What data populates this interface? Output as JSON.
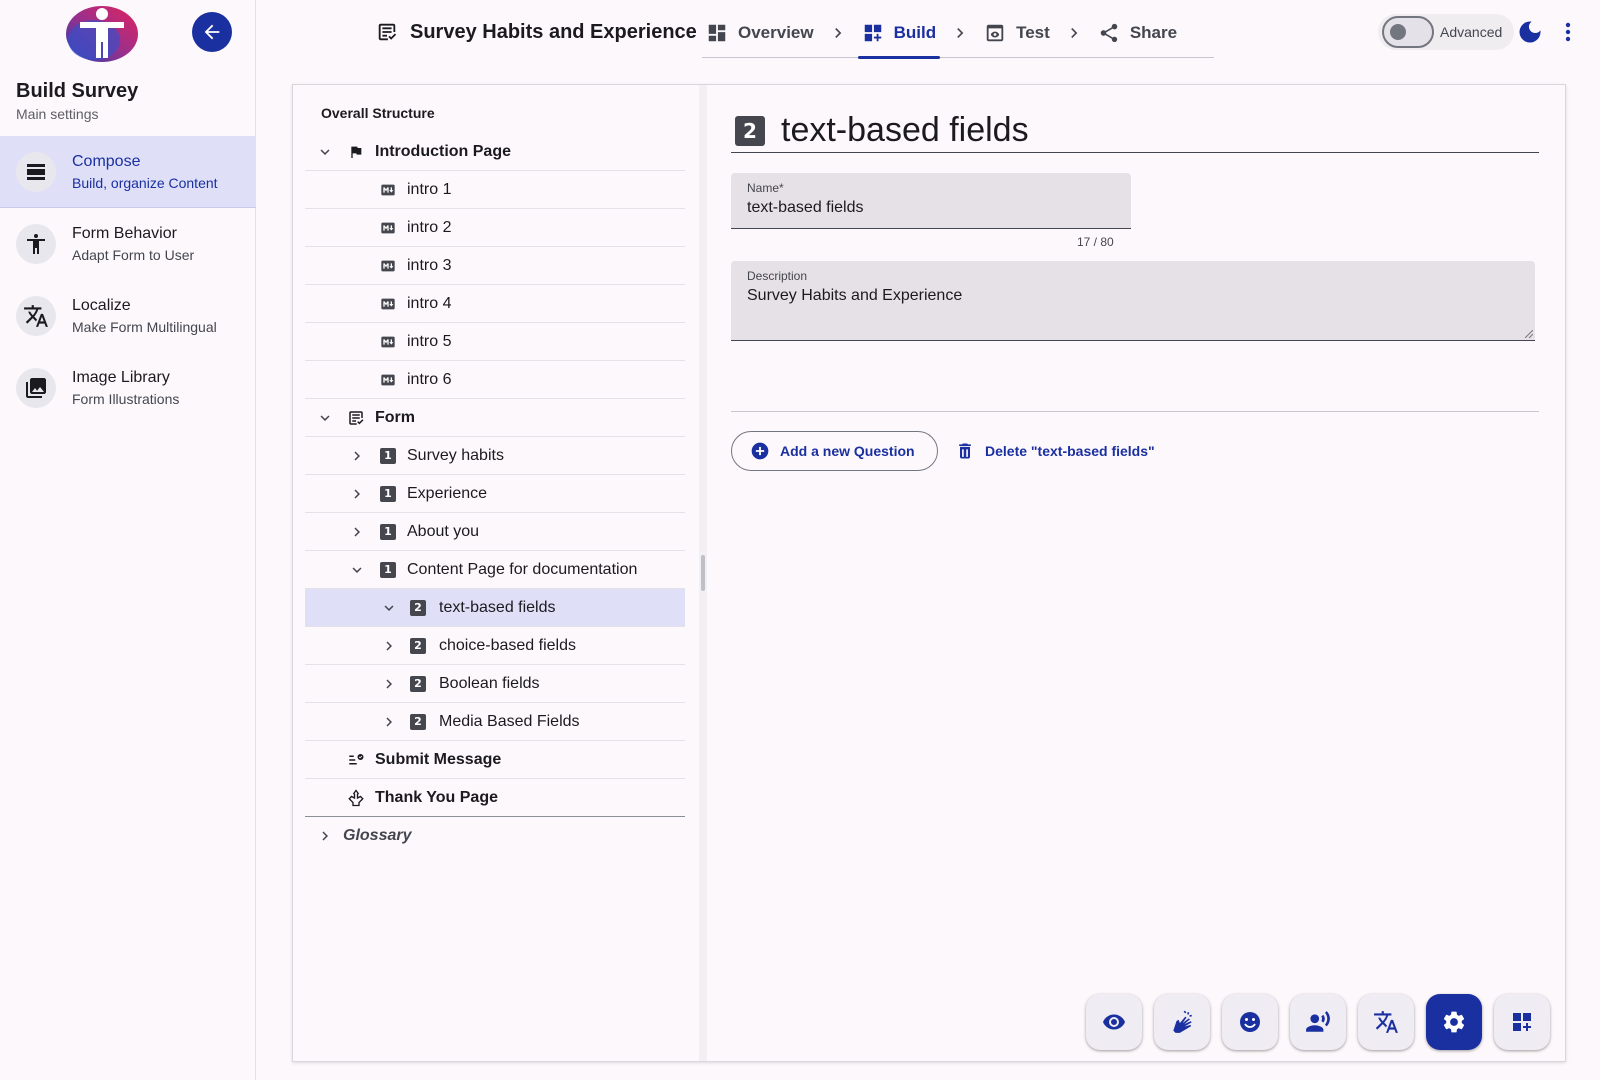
{
  "app": {
    "survey_title": "Survey Habits and Experience",
    "accent_color": "#1a2fa0"
  },
  "sidebar": {
    "title": "Build Survey",
    "subtitle": "Main settings",
    "items": [
      {
        "label": "Compose",
        "sub": "Build, organize Content",
        "icon": "compose-icon",
        "active": true
      },
      {
        "label": "Form Behavior",
        "sub": "Adapt Form to User",
        "icon": "accessibility-icon",
        "active": false
      },
      {
        "label": "Localize",
        "sub": "Make Form Multilingual",
        "icon": "translate-icon",
        "active": false
      },
      {
        "label": "Image Library",
        "sub": "Form Illustrations",
        "icon": "image-library-icon",
        "active": false
      }
    ]
  },
  "steps": [
    {
      "label": "Overview",
      "icon": "dashboard-icon",
      "active": false
    },
    {
      "label": "Build",
      "icon": "build-grid-icon",
      "active": true
    },
    {
      "label": "Test",
      "icon": "preview-icon",
      "active": false
    },
    {
      "label": "Share",
      "icon": "share-icon",
      "active": false
    }
  ],
  "advanced": {
    "label": "Advanced",
    "enabled": false
  },
  "tree": {
    "heading": "Overall Structure",
    "items": [
      {
        "label": "Introduction Page",
        "level": 0,
        "type": "section",
        "icon": "flag-icon",
        "expanded": true
      },
      {
        "label": "intro 1",
        "level": 1,
        "type": "markdown",
        "icon": "markdown-icon"
      },
      {
        "label": "intro 2",
        "level": 1,
        "type": "markdown",
        "icon": "markdown-icon"
      },
      {
        "label": "intro 3",
        "level": 1,
        "type": "markdown",
        "icon": "markdown-icon"
      },
      {
        "label": "intro 4",
        "level": 1,
        "type": "markdown",
        "icon": "markdown-icon"
      },
      {
        "label": "intro 5",
        "level": 1,
        "type": "markdown",
        "icon": "markdown-icon"
      },
      {
        "label": "intro 6",
        "level": 1,
        "type": "markdown",
        "icon": "markdown-icon"
      },
      {
        "label": "Form",
        "level": 0,
        "type": "section",
        "icon": "form-icon",
        "expanded": true
      },
      {
        "label": "Survey habits",
        "level": 1,
        "type": "page",
        "badge": "1",
        "expanded": false
      },
      {
        "label": "Experience",
        "level": 1,
        "type": "page",
        "badge": "1",
        "expanded": false
      },
      {
        "label": "About you",
        "level": 1,
        "type": "page",
        "badge": "1",
        "expanded": false
      },
      {
        "label": "Content Page for documentation",
        "level": 1,
        "type": "page",
        "badge": "1",
        "expanded": true
      },
      {
        "label": "text-based fields",
        "level": 2,
        "type": "group",
        "badge": "2",
        "expanded": true,
        "selected": true
      },
      {
        "label": "choice-based fields",
        "level": 2,
        "type": "group",
        "badge": "2",
        "expanded": false
      },
      {
        "label": "Boolean fields",
        "level": 2,
        "type": "group",
        "badge": "2",
        "expanded": false
      },
      {
        "label": "Media Based Fields",
        "level": 2,
        "type": "group",
        "badge": "2",
        "expanded": false
      },
      {
        "label": "Submit Message",
        "level": 0,
        "type": "section",
        "icon": "submit-message-icon"
      },
      {
        "label": "Thank You Page",
        "level": 0,
        "type": "section",
        "icon": "thank-you-icon"
      },
      {
        "label": "Glossary",
        "level": 0,
        "type": "glossary",
        "expanded": false
      }
    ]
  },
  "editor": {
    "badge": "2",
    "title": "text-based fields",
    "name_label": "Name*",
    "name_value": "text-based fields",
    "name_counter": "17 / 80",
    "description_label": "Description",
    "description_value": "Survey Habits and Experience",
    "add_question_label": "Add a new Question",
    "delete_label": "Delete \"text-based fields\""
  },
  "toolbar": [
    {
      "name": "preview-toggle",
      "icon": "eye-icon",
      "active": false
    },
    {
      "name": "sign-language-toggle",
      "icon": "sign-language-icon",
      "active": false
    },
    {
      "name": "easy-language-toggle",
      "icon": "smiley-icon",
      "active": false
    },
    {
      "name": "audio-toggle",
      "icon": "voice-icon",
      "active": false
    },
    {
      "name": "translate-toggle",
      "icon": "translate-icon",
      "active": false
    },
    {
      "name": "settings-toggle",
      "icon": "gear-icon",
      "active": true
    },
    {
      "name": "add-element-toggle",
      "icon": "add-grid-icon",
      "active": false
    }
  ]
}
